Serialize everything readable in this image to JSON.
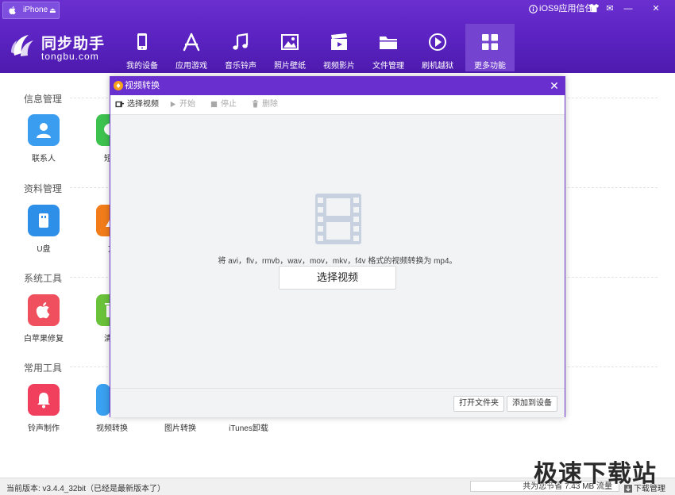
{
  "topbar": {
    "device_name": "iPhone",
    "eject_glyph": "⏏",
    "trust_text": "iOS9应用信任",
    "window_buttons": [
      "✉",
      "—",
      "✕"
    ]
  },
  "logo": {
    "brand_name": "同步助手",
    "domain": "tongbu.com"
  },
  "nav": [
    {
      "label": "我的设备",
      "icon": "phone-icon"
    },
    {
      "label": "应用游戏",
      "icon": "app-store-icon"
    },
    {
      "label": "音乐铃声",
      "icon": "music-icon"
    },
    {
      "label": "照片壁纸",
      "icon": "photo-icon"
    },
    {
      "label": "视频影片",
      "icon": "clapper-icon"
    },
    {
      "label": "文件管理",
      "icon": "folder-icon"
    },
    {
      "label": "刷机越狱",
      "icon": "flash-icon"
    },
    {
      "label": "更多功能",
      "icon": "grid-icon",
      "active": true
    }
  ],
  "sections": [
    {
      "title": "信息管理",
      "tools": [
        {
          "label": "联系人",
          "color": "#3a9df0"
        },
        {
          "label": "短信",
          "color": "#3ec24f"
        }
      ]
    },
    {
      "title": "资料管理",
      "tools": [
        {
          "label": "U盘",
          "color": "#2e8fe8"
        },
        {
          "label": "文",
          "color": "#f27c1a"
        }
      ]
    },
    {
      "title": "系统工具",
      "tools": [
        {
          "label": "白苹果修复",
          "color": "#f0505e"
        },
        {
          "label": "清理",
          "color": "#6ac23a"
        }
      ]
    },
    {
      "title": "常用工具",
      "tools": [
        {
          "label": "铃声制作",
          "color": "#f0405e"
        },
        {
          "label": "视频转换",
          "color": "#3aa0f0"
        },
        {
          "label": "图片转换"
        },
        {
          "label": "iTunes卸载"
        }
      ]
    }
  ],
  "dialog": {
    "title": "视频转换",
    "close_glyph": "✕",
    "toolbar": [
      {
        "label": "选择视频",
        "enabled": true
      },
      {
        "label": "开始",
        "enabled": false
      },
      {
        "label": "停止",
        "enabled": false
      },
      {
        "label": "删除",
        "enabled": false
      }
    ],
    "hint": "将 avi，flv，rmvb，wav，mov，mkv，f4v 格式的视频转换为 mp4。",
    "select_button": "选择视频",
    "footer": {
      "open_folder": "打开文件夹",
      "add_to_device": "添加到设备"
    }
  },
  "status": {
    "version": "当前版本: v3.4.4_32bit（已经是最新版本了）",
    "traffic": "共为您节省 7.43 MB 流量",
    "download_manager": "下载管理"
  },
  "watermark": "极速下载站",
  "colors": {
    "header": "#5a22c0",
    "dialog_title": "#6a2fcf",
    "film_icon": "#c7d1e0"
  }
}
